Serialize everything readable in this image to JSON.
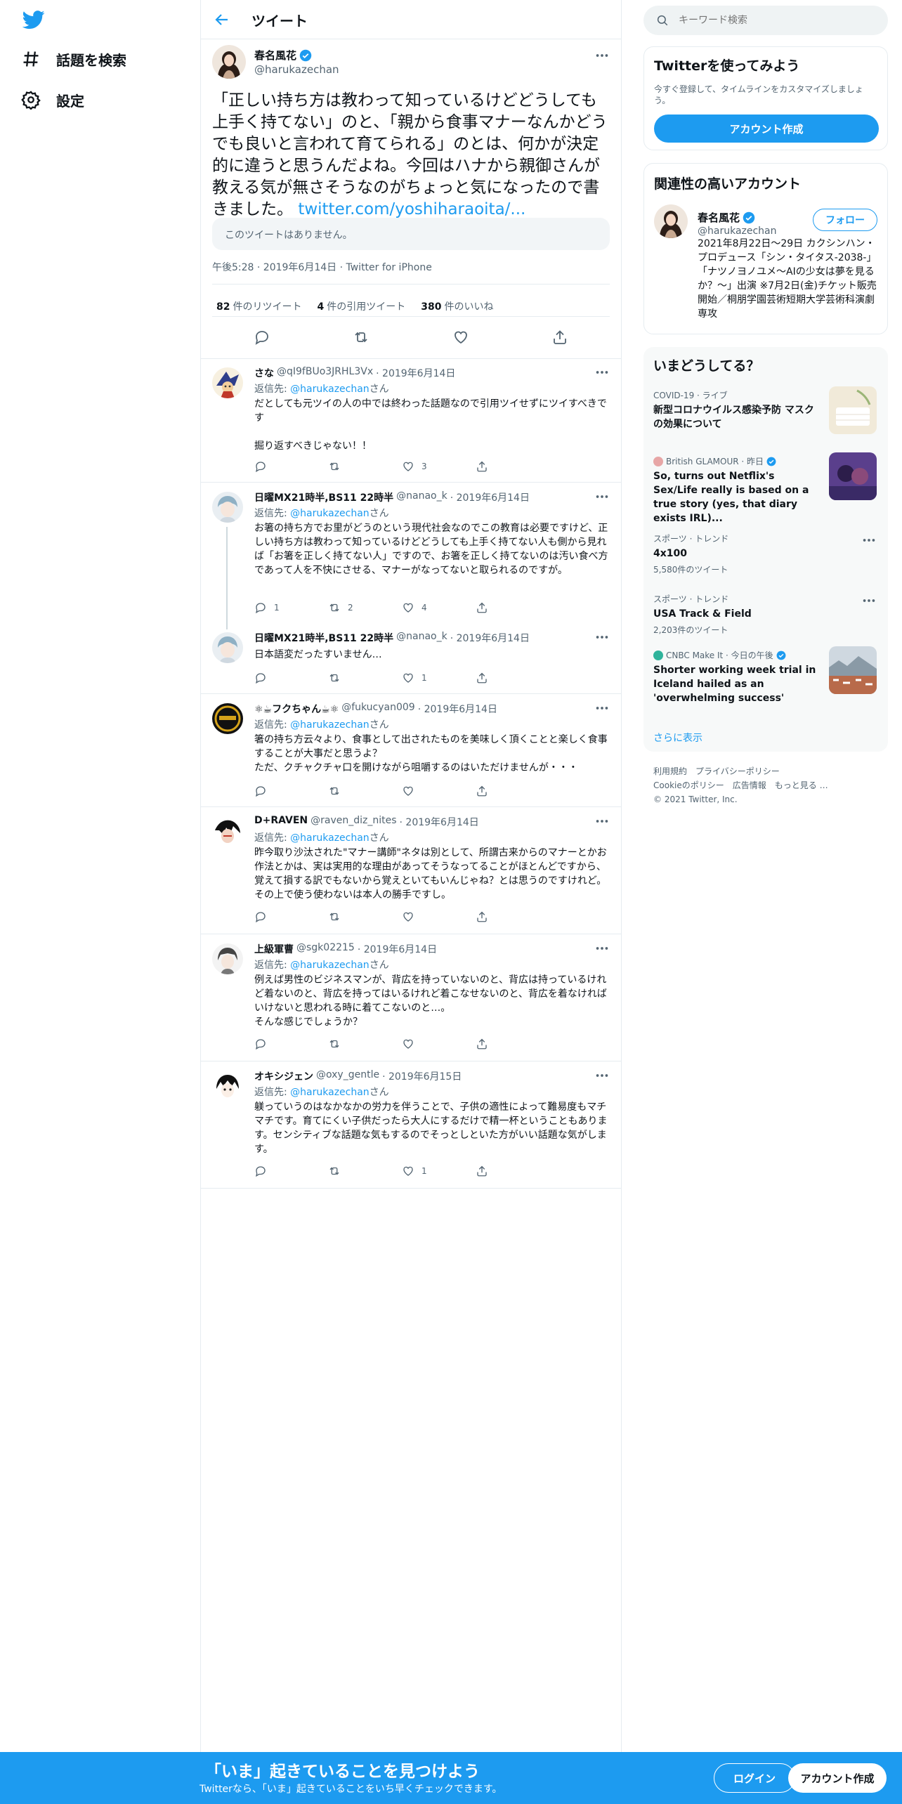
{
  "nav": {
    "explore_label": "話題を検索",
    "settings_label": "設定"
  },
  "header": {
    "title": "ツイート"
  },
  "main_tweet": {
    "name": "春名風花",
    "handle": "@harukazechan",
    "text": "「正しい持ち方は教わって知っているけどどうしても上手く持てない」のと、「親から食事マナーなんかどうでも良いと言われて育てられる」のとは、何かが決定的に違うと思うんだよね。今回はハナから親御さんが教える気が無さそうなのがちょっと気になったので書きました。",
    "link": "twitter.com/yoshiharaoita/...",
    "quoted_unavailable": "このツイートはありません。",
    "timestamp": "午後5:28 · 2019年6月14日 · Twitter for iPhone",
    "retweets": "82",
    "retweets_label": "件のリツイート",
    "quotes": "4",
    "quotes_label": "件の引用ツイート",
    "likes": "380",
    "likes_label": "件のいいね"
  },
  "replies": [
    {
      "name": "さな",
      "handle": "@qI9fBUo3JRHL3Vx",
      "date": "· 2019年6月14日",
      "reply_to_label": "返信先:",
      "reply_to": "@harukazechan",
      "reply_to_suffix": "さん",
      "text": "だとしても元ツイの人の中では終わった話題なので引用ツイせずにツイすべきです\n\n掘り返すべきじゃない！！",
      "likes": "3",
      "retweets": ""
    },
    {
      "name": "日曜MX21時半,BS11 22時半",
      "handle": "@nanao_k",
      "date": "· 2019年6月14日",
      "reply_to_label": "返信先:",
      "reply_to": "@harukazechan",
      "reply_to_suffix": "さん",
      "text": "お箸の持ち方でお里がどうのという現代社会なのでこの教育は必要ですけど、正しい持ち方は教わって知っているけどどうしても上手く持てない人も側から見れば「お箸を正しく持てない人」ですので、お箸を正しく持てないのは汚い食べ方であって人を不快にさせる、マナーがなってないと取られるのですが。",
      "replies": "1",
      "retweets": "2",
      "likes": "4"
    },
    {
      "name": "日曜MX21時半,BS11 22時半",
      "handle": "@nanao_k",
      "date": "· 2019年6月14日",
      "text": "日本語変だったすいません…",
      "likes": "1"
    },
    {
      "name": "⚛☕フクちゃん☕⚛",
      "handle": "@fukucyan009",
      "date": "· 2019年6月14日",
      "reply_to_label": "返信先:",
      "reply_to": "@harukazechan",
      "reply_to_suffix": "さん",
      "text": "箸の持ち方云々より、食事として出されたものを美味しく頂くことと楽しく食事することが大事だと思うよ？\nただ、クチャクチャ口を開けながら咀嚼するのはいただけませんが・・・"
    },
    {
      "name": "D+RAVEN",
      "handle": "@raven_diz_nites",
      "date": "· 2019年6月14日",
      "reply_to_label": "返信先:",
      "reply_to": "@harukazechan",
      "reply_to_suffix": "さん",
      "text": "昨今取り沙汰された\"マナー講師\"ネタは別として、所謂古来からのマナーとかお作法とかは、実は実用的な理由があってそうなってることがほとんどですから、覚えて損する訳でもないから覚えといてもいんじゃね？とは思うのですけれど。その上で使う使わないは本人の勝手ですし。"
    },
    {
      "name": "上級軍曹",
      "handle": "@sgk02215",
      "date": "· 2019年6月14日",
      "reply_to_label": "返信先:",
      "reply_to": "@harukazechan",
      "reply_to_suffix": "さん",
      "text": "例えば男性のビジネスマンが、背広を持っていないのと、背広は持っているけれど着ないのと、背広を持ってはいるけれど着こなせないのと、背広を着なければいけないと思われる時に着てこないのと…。\nそんな感じでしょうか？"
    },
    {
      "name": "オキシジェン",
      "handle": "@oxy_gentle",
      "date": "· 2019年6月15日",
      "reply_to_label": "返信先:",
      "reply_to": "@harukazechan",
      "reply_to_suffix": "さん",
      "text": "躾っていうのはなかなかの労力を伴うことで、子供の適性によって難易度もマチマチです。育てにくい子供だったら大人にするだけで精一杯ということもあります。センシティブな話題な気もするのでそっとしといた方がいい話題な気がします。",
      "likes": "1"
    }
  ],
  "sidebar": {
    "search_placeholder": "キーワード検索",
    "signup_title": "Twitterを使ってみよう",
    "signup_sub": "今すぐ登録して、タイムラインをカスタマイズしましょう。",
    "signup_button": "アカウント作成",
    "related_title": "関連性の高いアカウント",
    "related_name": "春名風花",
    "related_handle": "@harukazechan",
    "follow_label": "フォロー",
    "related_bio": "2021年8月22日～29日 カクシンハン・プロデュース「シン・タイタス-2038-」「ナツノヨノユメ～AIの少女は夢を見るか？～」出演 ※7月2日(金)チケット販売開始／桐朋学園芸術短期大学芸術科演劇専攻",
    "trends_title": "いまどうしてる？",
    "trends": [
      {
        "context": "COVID-19 · ライブ",
        "title": "新型コロナウイルス感染予防 マスクの効果について"
      },
      {
        "context": "British GLAMOUR · 昨日",
        "title": "So, turns out Netflix's Sex/Life really is based on a true story (yes, that diary exists IRL)..."
      },
      {
        "context": "スポーツ · トレンド",
        "title": "4x100",
        "count": "5,580件のツイート"
      },
      {
        "context": "スポーツ · トレンド",
        "title": "USA Track & Field",
        "count": "2,203件のツイート"
      },
      {
        "context": "CNBC Make It · 今日の午後",
        "title": "Shorter working week trial in Iceland hailed as an 'overwhelming success'"
      }
    ],
    "show_more": "さらに表示",
    "footer": [
      "利用規約",
      "プライバシーポリシー",
      "Cookieのポリシー",
      "広告情報",
      "もっと見る …"
    ],
    "copyright": "© 2021 Twitter, Inc."
  },
  "bottom_bar": {
    "title": "「いま」起きていることを見つけよう",
    "subtitle": "Twitterなら、「いま」起きていることをいち早くチェックできます。",
    "login": "ログイン",
    "signup": "アカウント作成"
  },
  "colors": {
    "accent": "#1d9bf0",
    "border": "#e6ecf0",
    "secondary_text": "#536471"
  }
}
